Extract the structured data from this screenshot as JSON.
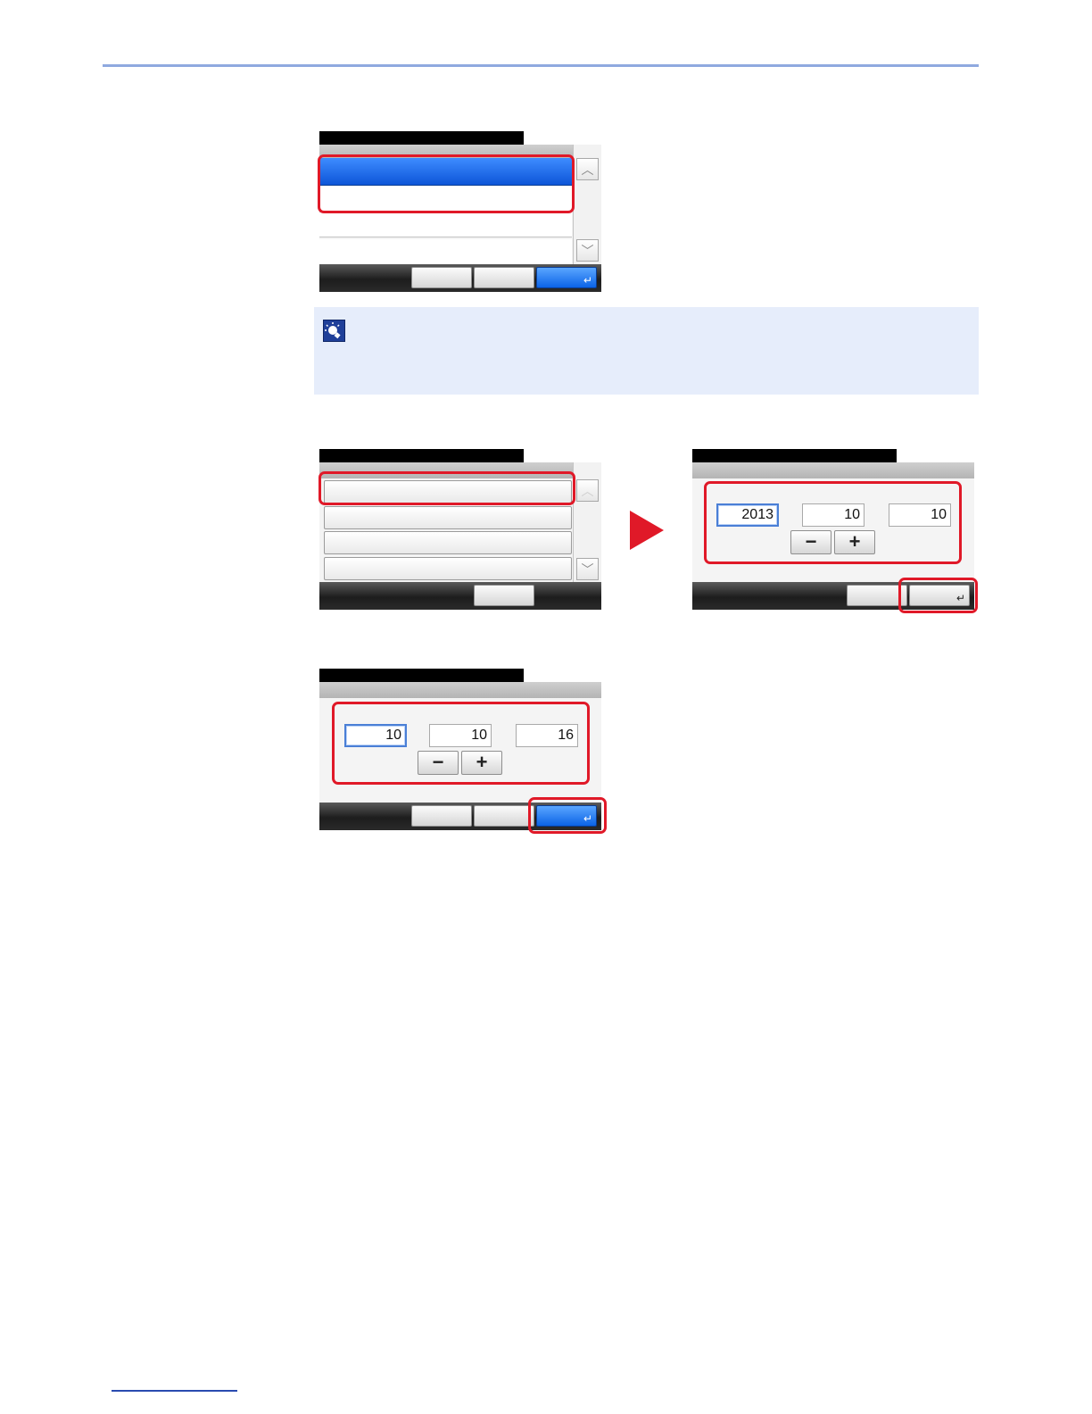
{
  "screen_date": {
    "fields": [
      "2013",
      "10",
      "10"
    ],
    "minus_label": "−",
    "plus_label": "+",
    "enter_symbol": "↵"
  },
  "screen_time": {
    "fields": [
      "10",
      "10",
      "16"
    ],
    "minus_label": "−",
    "plus_label": "+",
    "enter_symbol": "↵"
  },
  "screen_list_1": {
    "enter_symbol": "↵",
    "scroll_up": "︿",
    "scroll_down": "﹀"
  },
  "screen_list_2": {
    "scroll_up": "︿",
    "scroll_down": "﹀"
  },
  "icons": {
    "note": "lightbulb-icon",
    "step_arrow": "play-triangle-icon"
  },
  "colors": {
    "highlight": "#e01928",
    "selected_blue": "#0d55d8",
    "note_bg": "#e6edfb",
    "rule": "#8fa9df"
  }
}
